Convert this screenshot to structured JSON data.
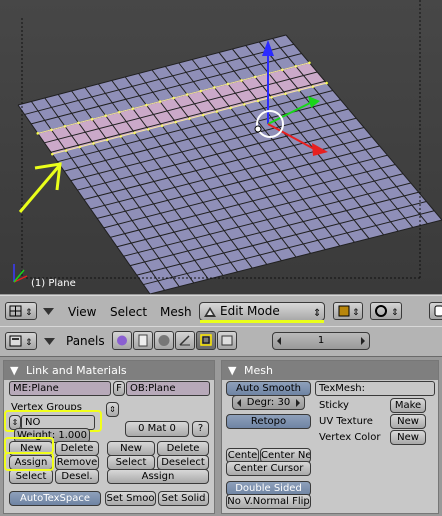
{
  "viewport": {
    "object_label": "(1) Plane",
    "annotation_color": "#eaff1a"
  },
  "header": {
    "menu_view": "View",
    "menu_select": "Select",
    "menu_mesh": "Mesh",
    "mode": "Edit Mode"
  },
  "buttons_header": {
    "panels_label": "Panels",
    "frame_value": "1"
  },
  "link_materials": {
    "title": "Link and Materials",
    "me_field": "ME:Plane",
    "f_label": "F",
    "ob_field": "OB:Plane",
    "vertex_groups_label": "Vertex Groups",
    "group_name": "NO",
    "weight": "Weight: 1.000",
    "mat_value": "0 Mat 0",
    "question": "?",
    "vg_new": "New",
    "vg_delete": "Delete",
    "vg_assign": "Assign",
    "vg_remove": "Remove",
    "vg_select": "Select",
    "vg_desel": "Desel.",
    "mat_new": "New",
    "mat_delete": "Delete",
    "mat_select": "Select",
    "mat_deselect": "Deselect",
    "mat_assign": "Assign",
    "autotexspace": "AutoTexSpace",
    "set_smooth": "Set Smoo",
    "set_solid": "Set Solid"
  },
  "mesh_panel": {
    "title": "Mesh",
    "auto_smooth": "Auto Smooth",
    "degr": "Degr: 30",
    "retopo": "Retopo",
    "center": "Cente",
    "center_new": "Center Ne",
    "center_cursor": "Center Cursor",
    "double_sided": "Double Sided",
    "no_vnormal_flip": "No V.Normal Flip",
    "texmesh": "TexMesh:",
    "sticky": "Sticky",
    "sticky_btn": "Make",
    "uv_texture": "UV Texture",
    "uv_btn": "New",
    "vertex_color": "Vertex Color",
    "vc_btn": "New"
  }
}
